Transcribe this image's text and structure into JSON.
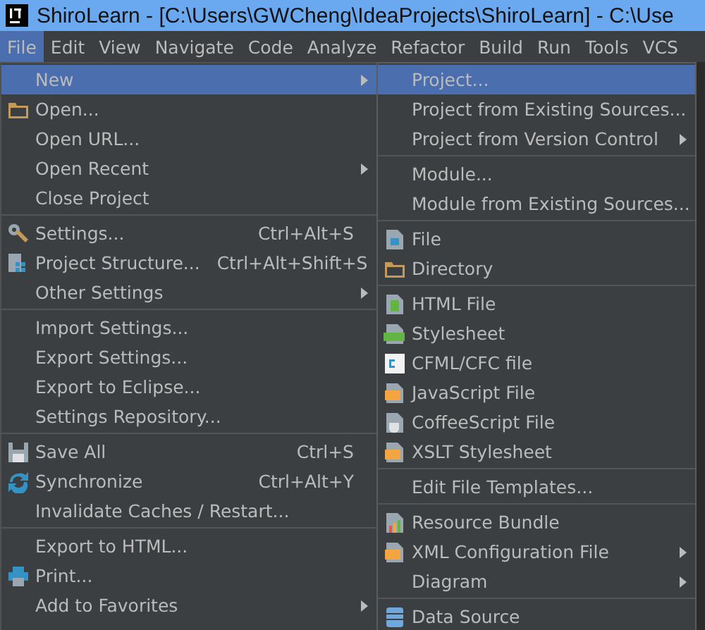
{
  "window": {
    "title": "ShiroLearn - [C:\\Users\\GWCheng\\IdeaProjects\\ShiroLearn] - C:\\Use"
  },
  "menu_bar": [
    {
      "label": "File",
      "selected": true
    },
    {
      "label": "Edit",
      "selected": false
    },
    {
      "label": "View",
      "selected": false
    },
    {
      "label": "Navigate",
      "selected": false
    },
    {
      "label": "Code",
      "selected": false
    },
    {
      "label": "Analyze",
      "selected": false
    },
    {
      "label": "Refactor",
      "selected": false
    },
    {
      "label": "Build",
      "selected": false
    },
    {
      "label": "Run",
      "selected": false
    },
    {
      "label": "Tools",
      "selected": false
    },
    {
      "label": "VCS",
      "selected": false
    }
  ],
  "file_menu": {
    "sections": [
      [
        {
          "label": "New",
          "submenu": true,
          "selected": true
        },
        {
          "label": "Open...",
          "kind": "folder",
          "submenu": false,
          "selected": false
        },
        {
          "label": "Open URL...",
          "submenu": false,
          "selected": false
        },
        {
          "label": "Open Recent",
          "submenu": true,
          "selected": false
        },
        {
          "label": "Close Project",
          "submenu": false,
          "selected": false
        }
      ],
      [
        {
          "label": "Settings...",
          "kind": "wrench",
          "shortcut": "Ctrl+Alt+S",
          "submenu": false,
          "selected": false
        },
        {
          "label": "Project Structure...",
          "kind": "structure",
          "shortcut": "Ctrl+Alt+Shift+S",
          "submenu": false,
          "selected": false
        },
        {
          "label": "Other Settings",
          "submenu": true,
          "selected": false
        }
      ],
      [
        {
          "label": "Import Settings...",
          "submenu": false,
          "selected": false
        },
        {
          "label": "Export Settings...",
          "submenu": false,
          "selected": false
        },
        {
          "label": "Export to Eclipse...",
          "submenu": false,
          "selected": false
        },
        {
          "label": "Settings Repository...",
          "submenu": false,
          "selected": false
        }
      ],
      [
        {
          "label": "Save All",
          "kind": "save",
          "shortcut": "Ctrl+S",
          "submenu": false,
          "selected": false
        },
        {
          "label": "Synchronize",
          "kind": "sync",
          "shortcut": "Ctrl+Alt+Y",
          "submenu": false,
          "selected": false
        },
        {
          "label": "Invalidate Caches / Restart...",
          "submenu": false,
          "selected": false
        }
      ],
      [
        {
          "label": "Export to HTML...",
          "submenu": false,
          "selected": false
        },
        {
          "label": "Print...",
          "kind": "print",
          "submenu": false,
          "selected": false
        },
        {
          "label": "Add to Favorites",
          "submenu": true,
          "selected": false
        }
      ]
    ]
  },
  "new_submenu": {
    "sections": [
      [
        {
          "label": "Project...",
          "submenu": false,
          "selected": true
        },
        {
          "label": "Project from Existing Sources...",
          "submenu": false,
          "selected": false
        },
        {
          "label": "Project from Version Control",
          "submenu": true,
          "selected": false
        }
      ],
      [
        {
          "label": "Module...",
          "submenu": false,
          "selected": false
        },
        {
          "label": "Module from Existing Sources...",
          "submenu": false,
          "selected": false
        }
      ],
      [
        {
          "label": "File",
          "kind": "file",
          "submenu": false,
          "selected": false
        },
        {
          "label": "Directory",
          "kind": "folder",
          "submenu": false,
          "selected": false
        }
      ],
      [
        {
          "label": "HTML File",
          "kind": "html",
          "submenu": false,
          "selected": false
        },
        {
          "label": "Stylesheet",
          "kind": "css",
          "submenu": false,
          "selected": false
        },
        {
          "label": "CFML/CFC file",
          "kind": "cf",
          "submenu": false,
          "selected": false
        },
        {
          "label": "JavaScript File",
          "kind": "js",
          "submenu": false,
          "selected": false
        },
        {
          "label": "CoffeeScript File",
          "kind": "coffee",
          "submenu": false,
          "selected": false
        },
        {
          "label": "XSLT Stylesheet",
          "kind": "xslt",
          "submenu": false,
          "selected": false
        }
      ],
      [
        {
          "label": "Edit File Templates...",
          "submenu": false,
          "selected": false
        }
      ],
      [
        {
          "label": "Resource Bundle",
          "kind": "bundle",
          "submenu": false,
          "selected": false
        },
        {
          "label": "XML Configuration File",
          "kind": "xml",
          "submenu": true,
          "selected": false
        },
        {
          "label": "Diagram",
          "submenu": true,
          "selected": false
        }
      ],
      [
        {
          "label": "Data Source",
          "kind": "datasource",
          "submenu": false,
          "selected": false
        }
      ]
    ]
  }
}
